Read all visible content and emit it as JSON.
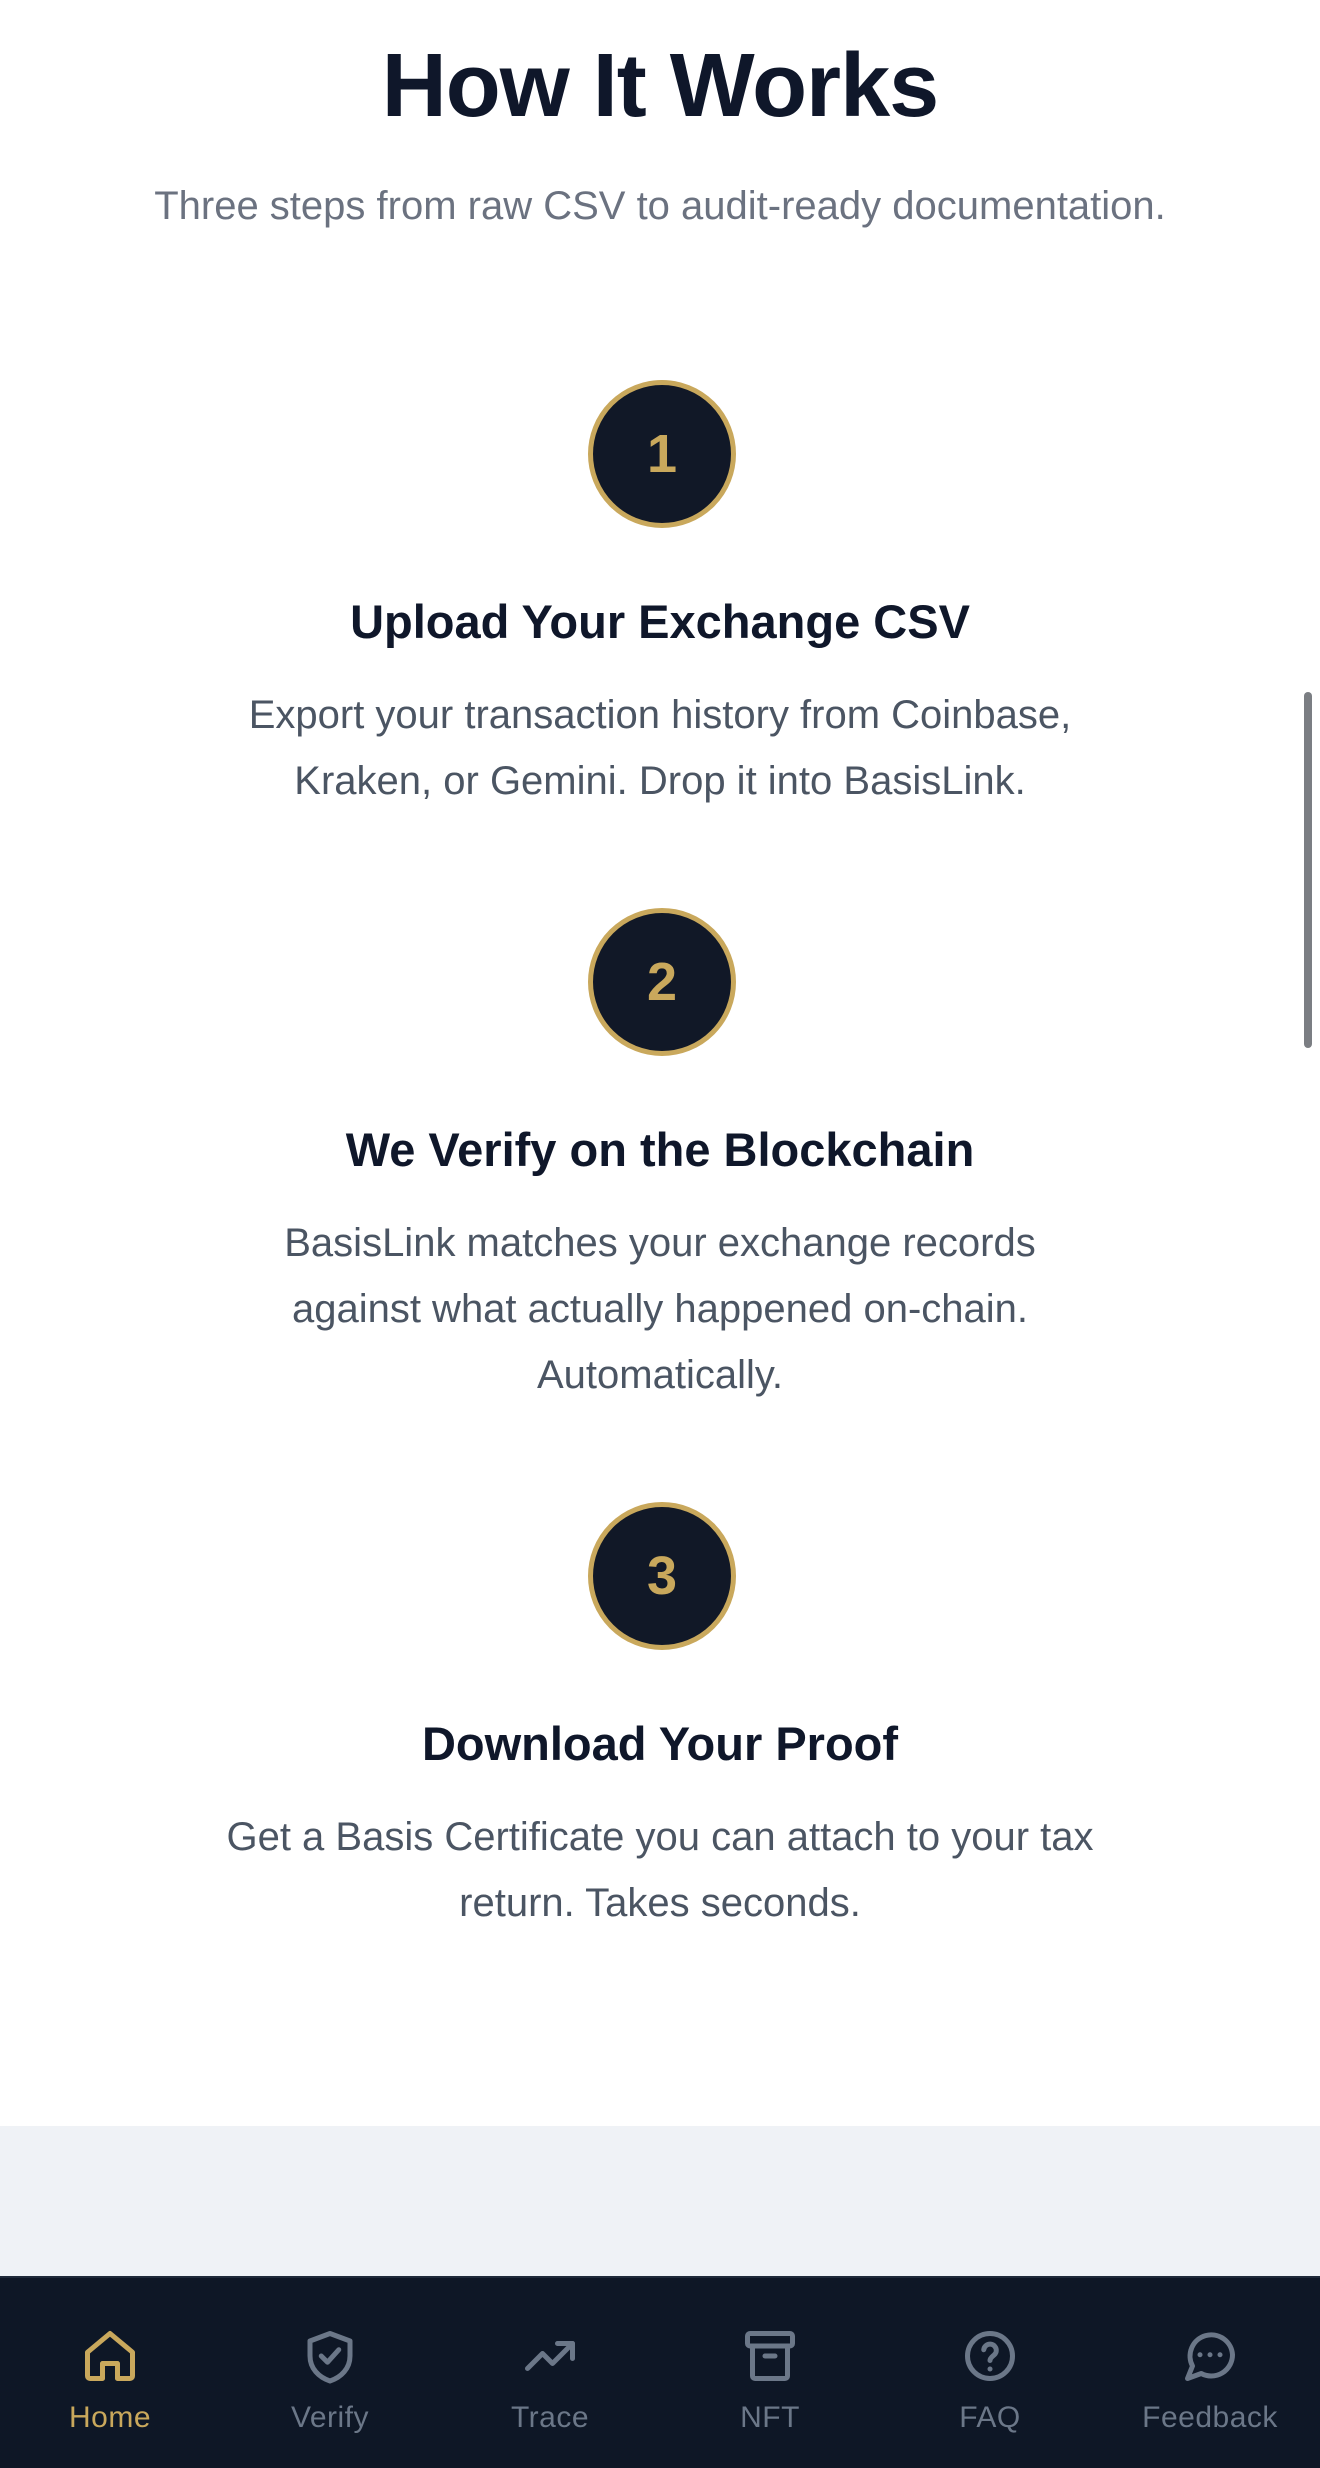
{
  "section": {
    "title": "How It Works",
    "subtitle": "Three steps from raw CSV to audit-ready documentation."
  },
  "steps": [
    {
      "number": "1",
      "title": "Upload Your Exchange CSV",
      "description_lines": [
        "Export your transaction history from Coinbase,",
        "Kraken, or Gemini. Drop it into BasisLink."
      ]
    },
    {
      "number": "2",
      "title": "We Verify on the Blockchain",
      "description_lines": [
        "BasisLink matches your exchange records",
        "against what actually happened on-chain.",
        "Automatically."
      ]
    },
    {
      "number": "3",
      "title": "Download Your Proof",
      "description_lines": [
        "Get a Basis Certificate you can attach to your tax",
        "return. Takes seconds."
      ]
    }
  ],
  "nav": {
    "items": [
      {
        "label": "Home",
        "icon": "home-icon",
        "active": true
      },
      {
        "label": "Verify",
        "icon": "shield-check-icon",
        "active": false
      },
      {
        "label": "Trace",
        "icon": "trending-up-icon",
        "active": false
      },
      {
        "label": "NFT",
        "icon": "archive-icon",
        "active": false
      },
      {
        "label": "FAQ",
        "icon": "help-circle-icon",
        "active": false
      },
      {
        "label": "Feedback",
        "icon": "message-circle-icon",
        "active": false
      }
    ]
  },
  "colors": {
    "accent": "#c9a85c",
    "navy": "#111827",
    "nav_bg": "#0e1726",
    "nav_inactive": "#6b7788"
  }
}
